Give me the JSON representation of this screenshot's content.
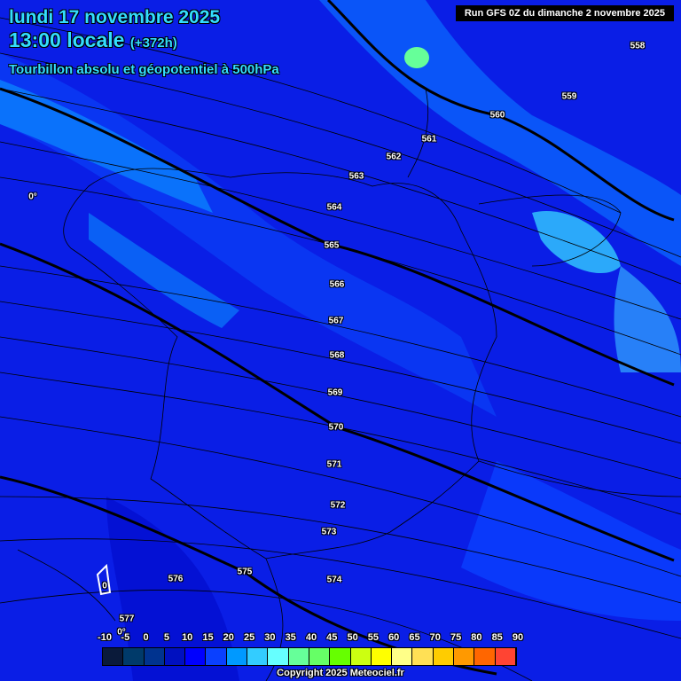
{
  "header": {
    "date": "lundi 17 novembre 2025",
    "time": "13:00 locale",
    "lead": "(+372h)",
    "parameter": "Tourbillon absolu et géopotentiel à 500hPa",
    "run": "Run GFS 0Z du dimanche 2 novembre 2025"
  },
  "contours": [
    "558",
    "559",
    "560",
    "561",
    "562",
    "563",
    "564",
    "565",
    "566",
    "567",
    "568",
    "569",
    "570",
    "571",
    "572",
    "573",
    "574",
    "575",
    "576",
    "577"
  ],
  "markers": {
    "zero_north": "0°",
    "zero_south": "0°",
    "zero_island": "0"
  },
  "legend": {
    "ticks": [
      "-10",
      "-5",
      "0",
      "5",
      "10",
      "15",
      "20",
      "25",
      "30",
      "35",
      "40",
      "45",
      "50",
      "55",
      "60",
      "65",
      "70",
      "75",
      "80",
      "85",
      "90"
    ],
    "colors": [
      "#0a1a3a",
      "#003a6a",
      "#00338f",
      "#0010c0",
      "#0000ff",
      "#0a40ff",
      "#0099ff",
      "#33ccff",
      "#66ffff",
      "#66ff99",
      "#66ff66",
      "#66ff00",
      "#ccff11",
      "#ffff00",
      "#ffff88",
      "#ffe055",
      "#ffcc00",
      "#ff9900",
      "#ff6600",
      "#ff4433",
      "#ff3300"
    ]
  },
  "copyright": "Copyright 2025 Meteociel.fr"
}
